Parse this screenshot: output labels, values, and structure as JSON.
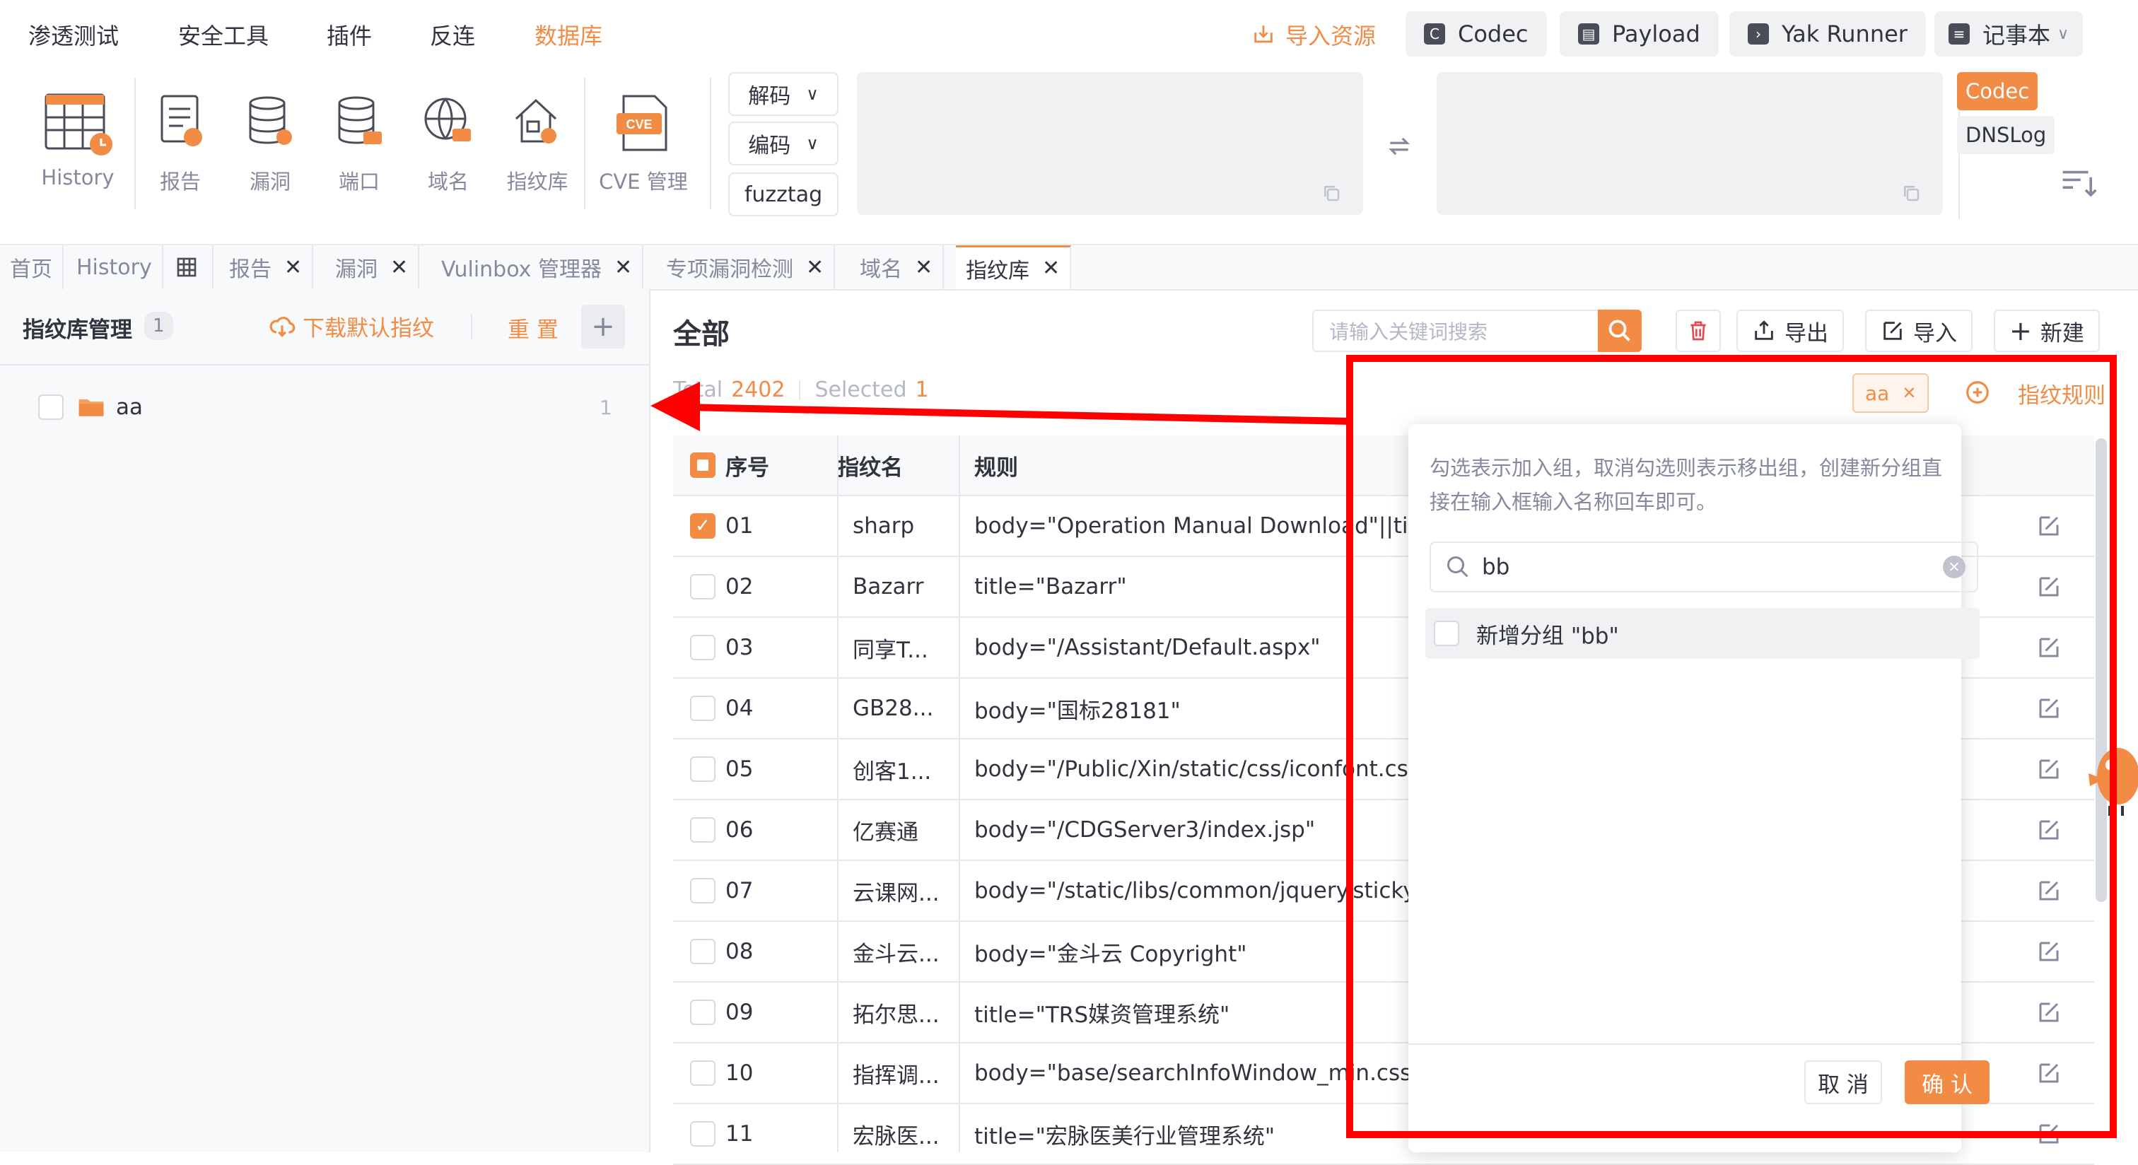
{
  "menu": [
    "渗透测试",
    "安全工具",
    "插件",
    "反连",
    "数据库"
  ],
  "menu_active": "数据库",
  "header": {
    "import_resources": "导入资源",
    "buttons": [
      "Codec",
      "Payload",
      "Yak Runner",
      "记事本"
    ]
  },
  "toolbar": {
    "tools": [
      "History",
      "报告",
      "漏洞",
      "端口",
      "域名",
      "指纹库",
      "CVE 管理"
    ],
    "codec_buttons": [
      "解码",
      "编码",
      "fuzztag"
    ],
    "side_tags": [
      "Codec",
      "DNSLog"
    ],
    "cve_badge": "CVE"
  },
  "tabs": [
    {
      "label": "首页",
      "closable": false
    },
    {
      "label": "History",
      "closable": false
    },
    {
      "label": "",
      "closable": false,
      "icon": "table-icon"
    },
    {
      "label": "报告",
      "closable": true
    },
    {
      "label": "漏洞",
      "closable": true
    },
    {
      "label": "Vulinbox 管理器",
      "closable": true
    },
    {
      "label": "专项漏洞检测",
      "closable": true
    },
    {
      "label": "域名",
      "closable": true
    },
    {
      "label": "指纹库",
      "closable": true,
      "active": true
    }
  ],
  "left_panel": {
    "title": "指纹库管理",
    "count": "1",
    "download_default": "下载默认指纹",
    "reset": "重 置",
    "groups": [
      {
        "name": "aa",
        "count": "1"
      }
    ]
  },
  "main": {
    "title": "全部",
    "search_placeholder": "请输入关键词搜索",
    "export": "导出",
    "import": "导入",
    "new": "新建",
    "total_label": "Total",
    "total": "2402",
    "selected_label": "Selected",
    "selected": "1",
    "filter_tag": "aa",
    "rule_link": "指纹规则"
  },
  "table": {
    "columns": [
      "序号",
      "指纹名",
      "规则"
    ],
    "rows": [
      {
        "no": "01",
        "name": "sharp",
        "rule": "body=\"Operation Manual Download\"||title",
        "checked": true
      },
      {
        "no": "02",
        "name": "Bazarr",
        "rule": "title=\"Bazarr\"",
        "checked": false
      },
      {
        "no": "03",
        "name": "同享T...",
        "rule": "body=\"/Assistant/Default.aspx\"",
        "checked": false
      },
      {
        "no": "04",
        "name": "GB28...",
        "rule": "body=\"国标28181\"",
        "checked": false
      },
      {
        "no": "05",
        "name": "创客1...",
        "rule": "body=\"/Public/Xin/static/css/iconfont.css\"",
        "checked": false
      },
      {
        "no": "06",
        "name": "亿赛通",
        "rule": "body=\"/CDGServer3/index.jsp\"",
        "checked": false
      },
      {
        "no": "07",
        "name": "云课网...",
        "rule": "body=\"/static/libs/common/jquery.stickyN",
        "checked": false
      },
      {
        "no": "08",
        "name": "金斗云...",
        "rule": "body=\"金斗云 Copyright\"",
        "checked": false
      },
      {
        "no": "09",
        "name": "拓尔思...",
        "rule": "title=\"TRS媒资管理系统\"",
        "checked": false
      },
      {
        "no": "10",
        "name": "指挥调...",
        "rule": "body=\"base/searchInfoWindow_min.css\"",
        "checked": false
      },
      {
        "no": "11",
        "name": "宏脉医...",
        "rule": "title=\"宏脉医美行业管理系统\"",
        "checked": false
      }
    ]
  },
  "popover": {
    "tip": "勾选表示加入组，取消勾选则表示移出组，创建新分组直接在输入框输入名称回车即可。",
    "input_value": "bb",
    "new_group_option": "新增分组 \"bb\"",
    "cancel": "取 消",
    "confirm": "确 认"
  },
  "colors": {
    "accent": "#f28b44",
    "annotation": "#ff0000",
    "text": "#31343f",
    "muted": "#85899e"
  }
}
